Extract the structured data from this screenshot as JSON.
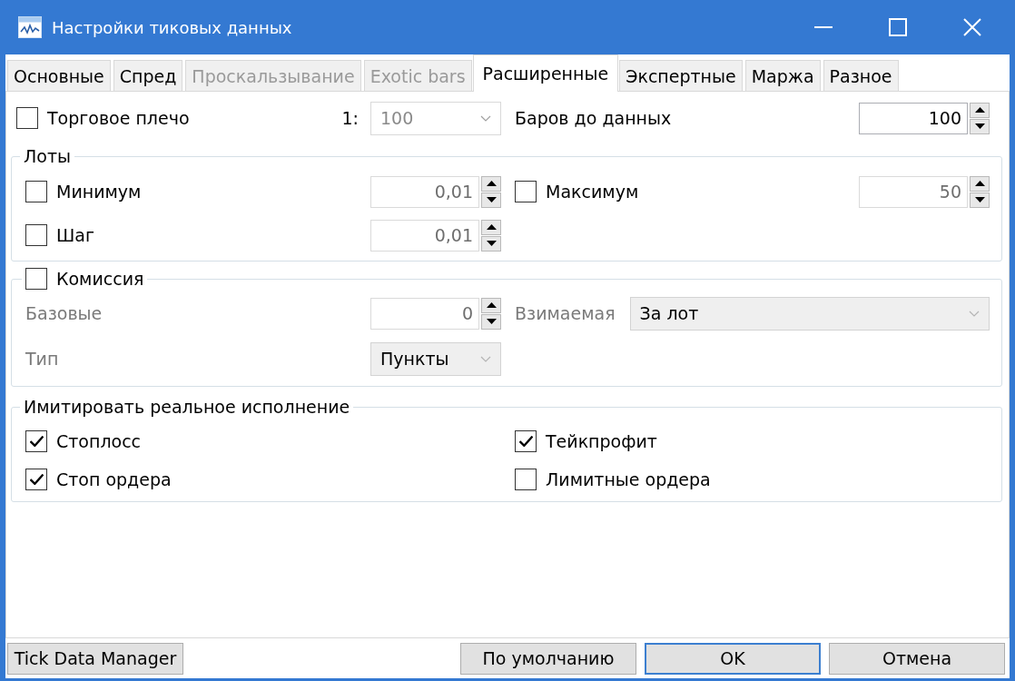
{
  "window": {
    "title": "Настройки тиковых данных"
  },
  "tabs": [
    {
      "label": "Основные",
      "selected": false,
      "disabled": false
    },
    {
      "label": "Спред",
      "selected": false,
      "disabled": false
    },
    {
      "label": "Проскальзывание",
      "selected": false,
      "disabled": true
    },
    {
      "label": "Exotic bars",
      "selected": false,
      "disabled": true
    },
    {
      "label": "Расширенные",
      "selected": true,
      "disabled": false
    },
    {
      "label": "Экспертные",
      "selected": false,
      "disabled": false
    },
    {
      "label": "Маржа",
      "selected": false,
      "disabled": false
    },
    {
      "label": "Разное",
      "selected": false,
      "disabled": false
    }
  ],
  "leverage": {
    "label": "Торговое плечо",
    "checked": false,
    "ratio_prefix": "1:",
    "value": "100",
    "disabled": true
  },
  "bars_before_data": {
    "label": "Баров до данных",
    "value": "100",
    "disabled": false
  },
  "lots": {
    "title": "Лоты",
    "fields": [
      {
        "label": "Минимум",
        "checked": false,
        "value": "0,01",
        "disabled": true
      },
      {
        "label": "Максимум",
        "checked": false,
        "value": "50",
        "disabled": true
      },
      {
        "label": "Шаг",
        "checked": false,
        "value": "0,01",
        "disabled": true
      }
    ]
  },
  "commission": {
    "label": "Комиссия",
    "checked": false,
    "fields": [
      {
        "kind": "number",
        "label": "Базовые",
        "value": "0",
        "disabled": true
      },
      {
        "kind": "select",
        "label": "Взимаемая",
        "value": "За лот",
        "disabled": true
      },
      {
        "kind": "select",
        "label": "Тип",
        "value": "Пункты",
        "disabled": true
      }
    ]
  },
  "real_execution": {
    "title": "Имитировать реальное исполнение",
    "options": [
      {
        "label": "Стоплосс",
        "checked": true
      },
      {
        "label": "Тейкпрофит",
        "checked": true
      },
      {
        "label": "Стоп ордера",
        "checked": true
      },
      {
        "label": "Лимитные ордера",
        "checked": false
      }
    ]
  },
  "buttons": [
    {
      "label": "Tick Data Manager",
      "default": false
    },
    {
      "label": "По умолчанию",
      "default": false
    },
    {
      "label": "OK",
      "default": true
    },
    {
      "label": "Отмена",
      "default": false
    }
  ]
}
